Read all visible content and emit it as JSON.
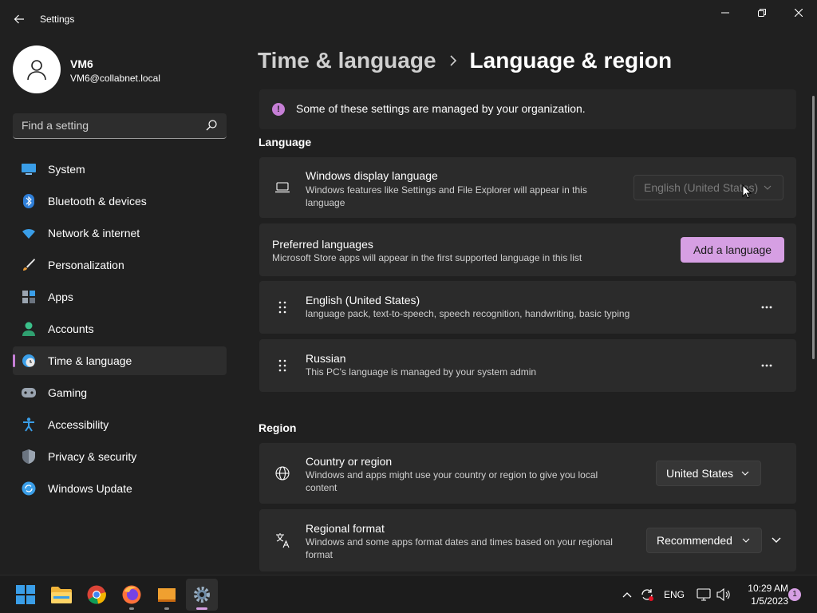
{
  "app": {
    "title": "Settings"
  },
  "user": {
    "name": "VM6",
    "email": "VM6@collabnet.local"
  },
  "search": {
    "placeholder": "Find a setting"
  },
  "nav": [
    {
      "label": "System",
      "icon": "system-icon",
      "selected": false
    },
    {
      "label": "Bluetooth & devices",
      "icon": "bluetooth-icon",
      "selected": false
    },
    {
      "label": "Network & internet",
      "icon": "wifi-icon",
      "selected": false
    },
    {
      "label": "Personalization",
      "icon": "brush-icon",
      "selected": false
    },
    {
      "label": "Apps",
      "icon": "apps-icon",
      "selected": false
    },
    {
      "label": "Accounts",
      "icon": "person-icon",
      "selected": false
    },
    {
      "label": "Time & language",
      "icon": "clock-globe-icon",
      "selected": true
    },
    {
      "label": "Gaming",
      "icon": "gamepad-icon",
      "selected": false
    },
    {
      "label": "Accessibility",
      "icon": "accessibility-icon",
      "selected": false
    },
    {
      "label": "Privacy & security",
      "icon": "shield-icon",
      "selected": false
    },
    {
      "label": "Windows Update",
      "icon": "update-icon",
      "selected": false
    }
  ],
  "breadcrumb": {
    "parent": "Time & language",
    "current": "Language & region"
  },
  "notice": {
    "text": "Some of these settings are managed by your organization."
  },
  "language": {
    "heading": "Language",
    "display": {
      "title": "Windows display language",
      "desc": "Windows features like Settings and File Explorer will appear in this language",
      "value": "English (United States)"
    },
    "preferred": {
      "title": "Preferred languages",
      "desc": "Microsoft Store apps will appear in the first supported language in this list",
      "button": "Add a language"
    },
    "items": [
      {
        "title": "English (United States)",
        "desc": "language pack, text-to-speech, speech recognition, handwriting, basic typing"
      },
      {
        "title": "Russian",
        "desc": "This PC's language is managed by your system admin"
      }
    ]
  },
  "region": {
    "heading": "Region",
    "country": {
      "title": "Country or region",
      "desc": "Windows and apps might use your country or region to give you local content",
      "value": "United States"
    },
    "format": {
      "title": "Regional format",
      "desc": "Windows and some apps format dates and times based on your regional format",
      "value": "Recommended"
    }
  },
  "taskbar": {
    "apps": [
      "start-icon",
      "file-explorer-icon",
      "chrome-icon",
      "firefox-icon",
      "folder-app-icon",
      "settings-icon"
    ],
    "tray": {
      "lang": "ENG",
      "time": "10:29 AM",
      "date": "1/5/2023",
      "notifications": "1"
    }
  },
  "colors": {
    "accent": "#d69fe3",
    "background": "#202020",
    "card": "#2b2b2b"
  }
}
